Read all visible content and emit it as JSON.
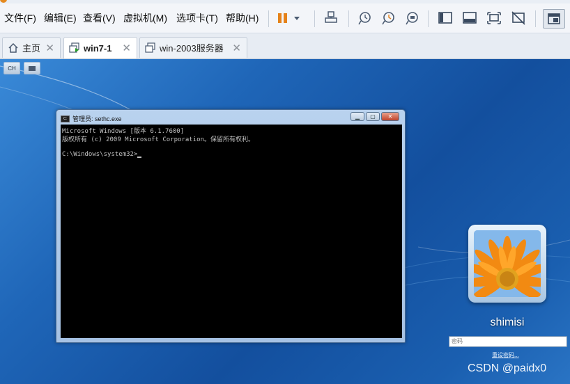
{
  "menubar": {
    "items": [
      "文件(F)",
      "编辑(E)",
      "查看(V)",
      "虚拟机(M)",
      "选项卡(T)",
      "帮助(H)"
    ]
  },
  "tabs": [
    {
      "label": "主页",
      "icon": "home-icon",
      "active": false
    },
    {
      "label": "win7-1",
      "icon": "vm-running-icon",
      "active": true
    },
    {
      "label": "win-2003服务器",
      "icon": "vm-icon",
      "active": false
    }
  ],
  "vm_top_buttons": [
    "CH"
  ],
  "cmd": {
    "title": "管理员: sethc.exe",
    "lines": [
      "Microsoft Windows [版本 6.1.7600]",
      "版权所有 (c) 2009 Microsoft Corporation。保留所有权利。",
      "",
      "C:\\Windows\\system32>"
    ]
  },
  "login": {
    "username": "shimisi",
    "password_placeholder": "密码",
    "reset_link": "重设密码..."
  },
  "watermark": "CSDN @paidx0",
  "colors": {
    "accent_orange": "#e5821a",
    "desktop_blue": "#1d5fa8"
  }
}
